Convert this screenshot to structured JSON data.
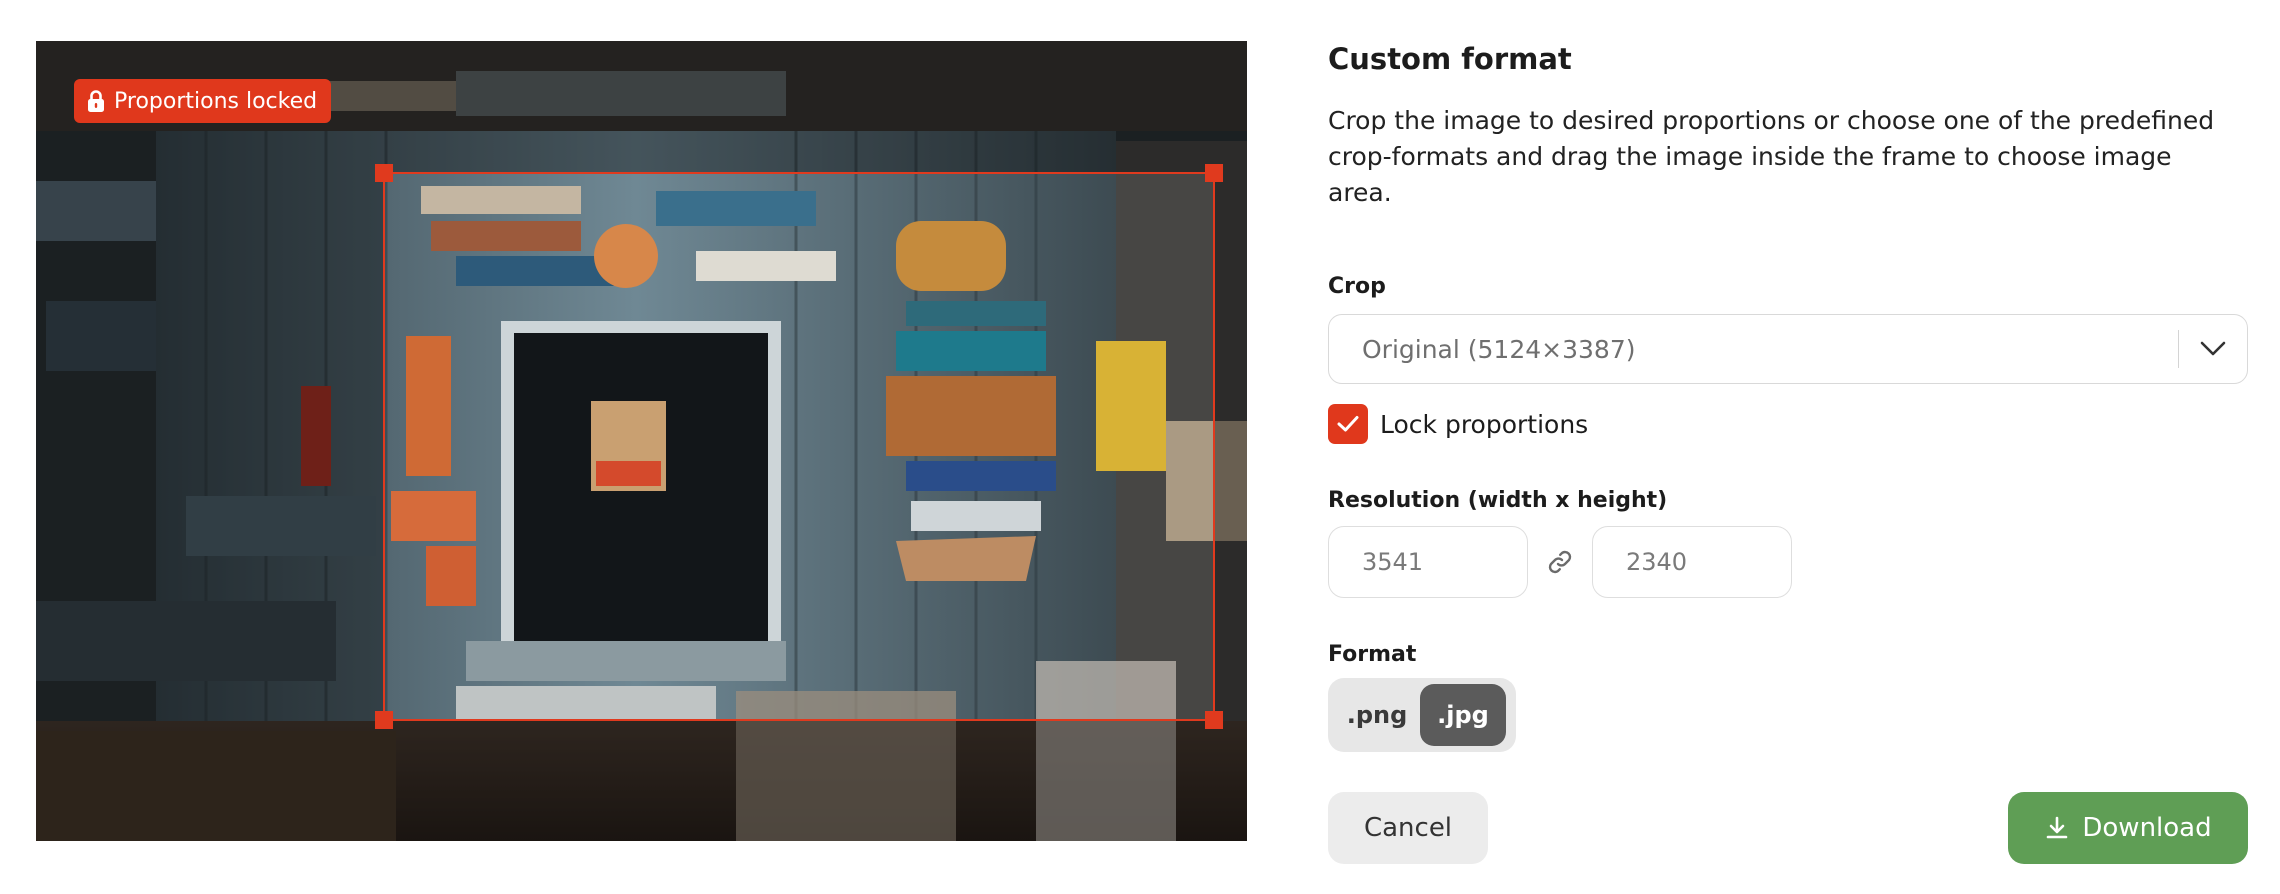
{
  "image": {
    "badge_text": "Proportions locked",
    "alt": "Shack wall with wooden signs"
  },
  "panel": {
    "title": "Custom format",
    "description": "Crop the image to desired proportions or choose one of the predefined crop-formats and drag the image inside the frame to choose image area.",
    "crop_label": "Crop",
    "crop_value": "Original (5124×3387)",
    "lock_label": "Lock proportions",
    "lock_checked": true,
    "resolution_label": "Resolution (width x height)",
    "width_value": "3541",
    "height_value": "2340",
    "format_label": "Format",
    "format_options": [
      ".png",
      ".jpg"
    ],
    "format_selected": ".jpg",
    "cancel_label": "Cancel",
    "download_label": "Download"
  },
  "colors": {
    "accent": "#e0381c",
    "download": "#5f9e55",
    "format_active": "#5b5b5b"
  },
  "icons": {
    "badge": "lock-icon",
    "select": "chevron-down-icon",
    "checkbox": "check-icon",
    "resolution": "link-icon",
    "download": "download-icon"
  }
}
